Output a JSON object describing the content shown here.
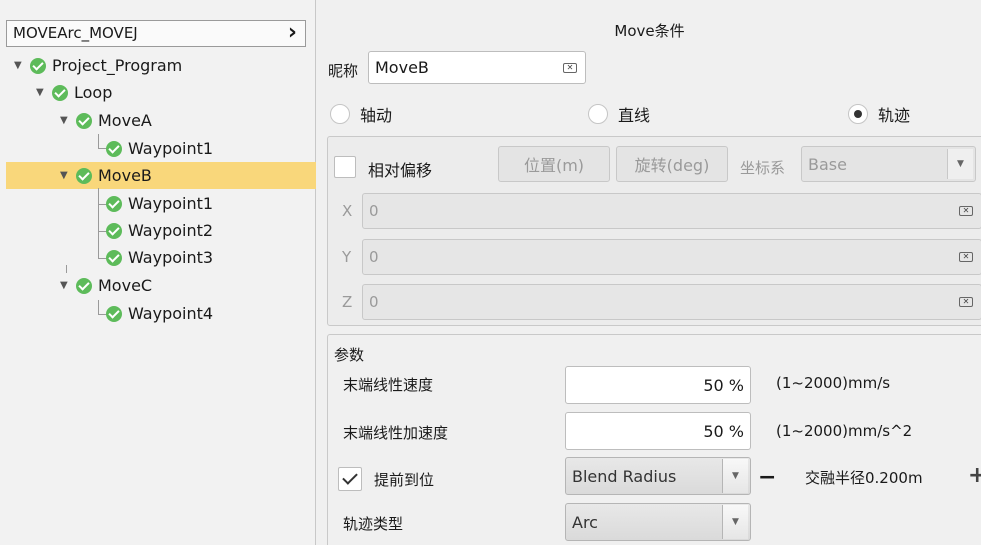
{
  "program": {
    "title": "MOVEArc_MOVEJ",
    "tree": [
      {
        "label": "Project_Program"
      },
      {
        "label": "Loop"
      },
      {
        "label": "MoveA"
      },
      {
        "label": "Waypoint1"
      },
      {
        "label": "MoveB"
      },
      {
        "label": "Waypoint1"
      },
      {
        "label": "Waypoint2"
      },
      {
        "label": "Waypoint3"
      },
      {
        "label": "MoveC"
      },
      {
        "label": "Waypoint4"
      }
    ],
    "selected": "MoveB"
  },
  "move": {
    "title": "Move条件",
    "nickname_label": "昵称",
    "nickname_value": "MoveB",
    "modes": [
      "轴动",
      "直线",
      "轨迹"
    ],
    "selected_mode": "轨迹"
  },
  "offset": {
    "relative_label": "相对偏移",
    "relative_checked": false,
    "position_btn": "位置(m)",
    "rotation_btn": "旋转(deg)",
    "coord_label": "坐标系",
    "coord_value": "Base",
    "x_label": "X",
    "x_value": "0",
    "y_label": "Y",
    "y_value": "0",
    "z_label": "Z",
    "z_value": "0"
  },
  "params": {
    "title": "参数",
    "speed_label": "末端线性速度",
    "speed_value": "50 %",
    "speed_range": "(1~2000)mm/s",
    "accel_label": "末端线性加速度",
    "accel_value": "50 %",
    "accel_range": "(1~2000)mm/s^2",
    "early_label": "提前到位",
    "early_checked": true,
    "early_mode": "Blend Radius",
    "blend_text": "交融半径0.200m",
    "traj_label": "轨迹类型",
    "traj_value": "Arc"
  },
  "colors": {
    "selection": "#f9d77b",
    "check": "#5dbb5a"
  }
}
